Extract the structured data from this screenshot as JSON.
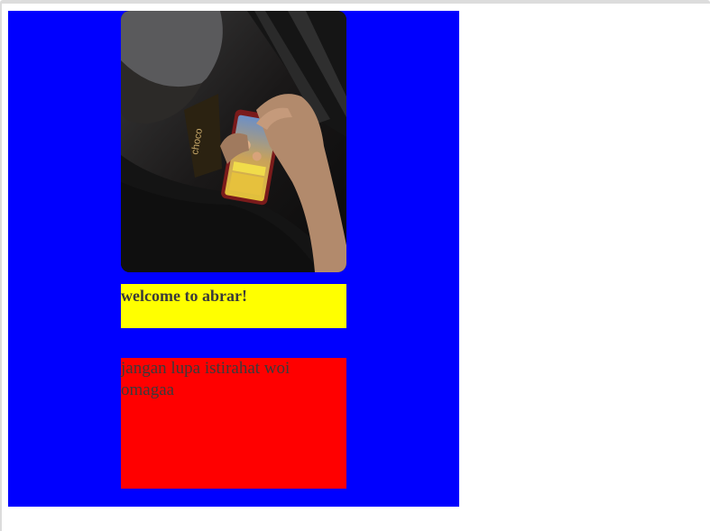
{
  "colors": {
    "panel": "#0000ff",
    "welcome_bg": "#ffff00",
    "message_bg": "#ff0000",
    "text": "#3a3a3a"
  },
  "photo": {
    "icon": "photo-person-holding-phone",
    "snack_wrapper_text": "choco"
  },
  "welcome": {
    "text": "welcome to abrar!"
  },
  "message": {
    "text": "jangan lupa istirahat woi omagaa"
  }
}
